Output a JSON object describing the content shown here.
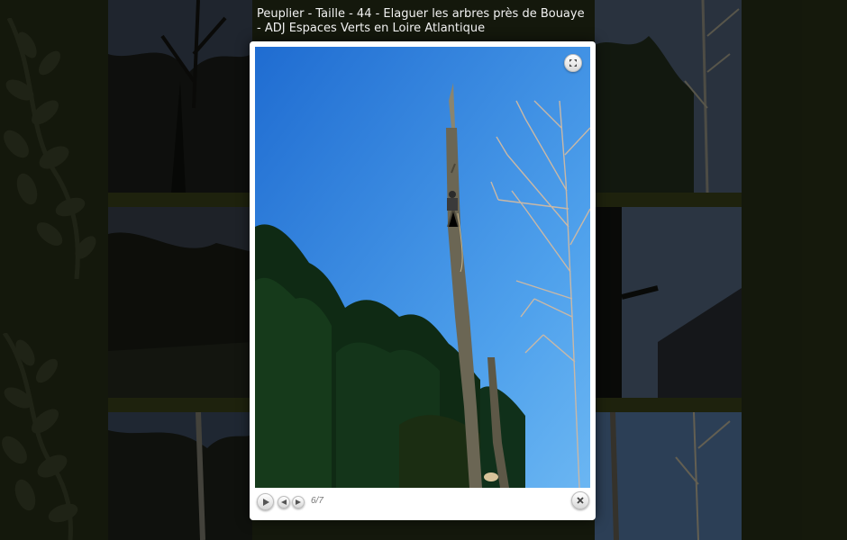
{
  "caption": {
    "title": "Peuplier - Taille - 44 - Elaguer les arbres près de Bouaye - ADJ Espaces Verts en Loire Atlantique"
  },
  "lightbox": {
    "counter": "6/7",
    "photo_alt": "Elagueur au sommet d'un peuplier"
  },
  "icons": {
    "expand": "expand-icon",
    "play": "play-icon",
    "prev": "previous-icon",
    "next": "next-icon",
    "close": "close-icon"
  },
  "colors": {
    "page_background": "#1d2211",
    "sky": "#2a7ad8",
    "lightbox_frame": "#ffffff"
  }
}
